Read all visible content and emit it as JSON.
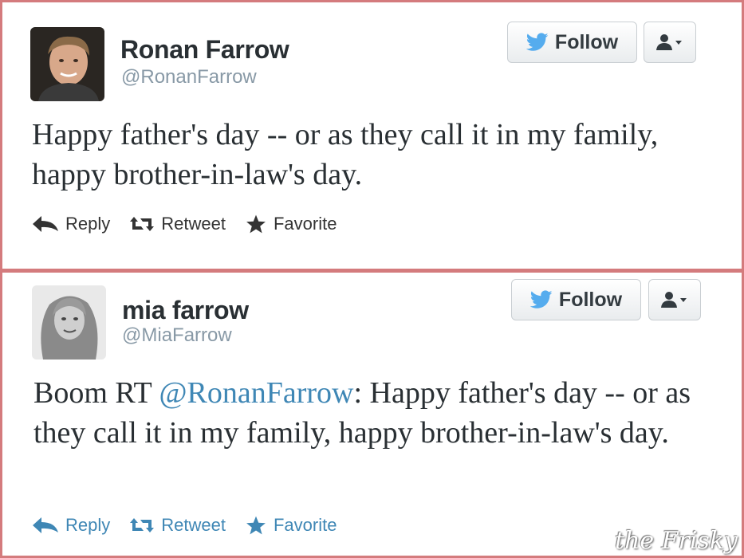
{
  "tweets": [
    {
      "name": "Ronan Farrow",
      "handle": "@RonanFarrow",
      "follow_label": "Follow",
      "text": "Happy father's day -- or as they call it in my family, happy brother-in-law's day.",
      "actions": {
        "reply": "Reply",
        "retweet": "Retweet",
        "favorite": "Favorite"
      }
    },
    {
      "name": "mia farrow",
      "handle": "@MiaFarrow",
      "follow_label": "Follow",
      "text_prefix": "Boom RT ",
      "mention": "@RonanFarrow",
      "text_suffix": ": Happy father's day -- or as they call it in my family, happy brother-in-law's day.",
      "actions": {
        "reply": "Reply",
        "retweet": "Retweet",
        "favorite": "Favorite"
      }
    }
  ],
  "watermark": "the Frisky",
  "colors": {
    "border": "#d47b7d",
    "link": "#3f87b5",
    "bird": "#55acee",
    "handle": "#8899a6"
  },
  "icons": [
    "twitter-bird-icon",
    "user-icon",
    "reply-icon",
    "retweet-icon",
    "favorite-icon"
  ]
}
